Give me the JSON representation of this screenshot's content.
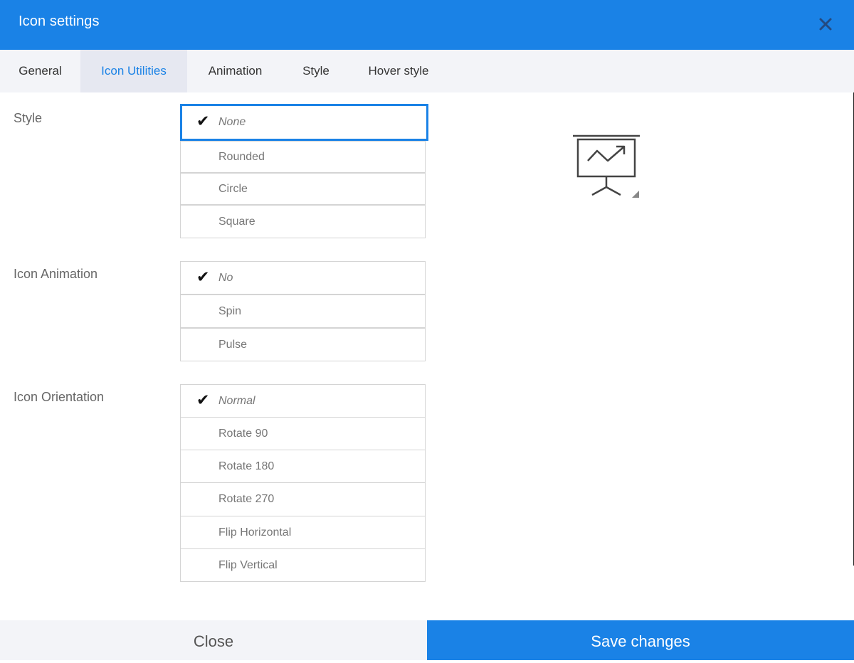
{
  "dialog": {
    "title": "Icon settings",
    "close_icon": "close-icon"
  },
  "tabs": [
    {
      "label": "General",
      "active": false
    },
    {
      "label": "Icon Utilities",
      "active": true
    },
    {
      "label": "Animation",
      "active": false
    },
    {
      "label": "Style",
      "active": false
    },
    {
      "label": "Hover style",
      "active": false
    }
  ],
  "sections": {
    "style": {
      "label": "Style",
      "selected": "None",
      "options": [
        "None",
        "Rounded",
        "Circle",
        "Square"
      ]
    },
    "animation": {
      "label": "Icon Animation",
      "selected": "No",
      "options": [
        "No",
        "Spin",
        "Pulse"
      ]
    },
    "orientation": {
      "label": "Icon Orientation",
      "selected": "Normal",
      "options": [
        "Normal",
        "Rotate 90",
        "Rotate 180",
        "Rotate 270",
        "Flip Horizontal",
        "Flip Vertical"
      ]
    }
  },
  "check_glyph": "✔",
  "preview": {
    "icon": "presentation-chart-icon"
  },
  "footer": {
    "close_label": "Close",
    "save_label": "Save changes"
  },
  "colors": {
    "accent": "#1a82e6",
    "tab_bar": "#f3f4f8",
    "active_tab": "#e6e8f1"
  }
}
